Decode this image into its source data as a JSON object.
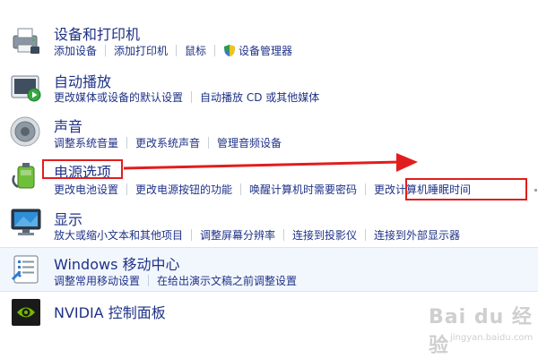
{
  "categories": [
    {
      "title": "设备和打印机",
      "icon": "printer-icon",
      "links": [
        "添加设备",
        "添加打印机",
        "鼠标",
        "设备管理器"
      ]
    },
    {
      "title": "自动播放",
      "icon": "autoplay-icon",
      "links": [
        "更改媒体或设备的默认设置",
        "自动播放 CD 或其他媒体"
      ]
    },
    {
      "title": "声音",
      "icon": "speaker-icon",
      "links": [
        "调整系统音量",
        "更改系统声音",
        "管理音频设备"
      ]
    },
    {
      "title": "电源选项",
      "icon": "power-options-icon",
      "links": [
        "更改电池设置",
        "更改电源按钮的功能",
        "唤醒计算机时需要密码",
        "更改计算机睡眠时间"
      ]
    },
    {
      "title": "显示",
      "icon": "display-icon",
      "links": [
        "放大或缩小文本和其他项目",
        "调整屏幕分辨率",
        "连接到投影仪",
        "连接到外部显示器"
      ]
    },
    {
      "title": "Windows 移动中心",
      "icon": "mobility-center-icon",
      "links": [
        "调整常用移动设置",
        "在给出演示文稿之前调整设置"
      ]
    },
    {
      "title": "NVIDIA 控制面板",
      "icon": "nvidia-icon",
      "links": []
    }
  ],
  "watermark": {
    "logo": "Bai du 经验",
    "url": "jingyan.baidu.com"
  },
  "colors": {
    "link": "#1e3287",
    "annotation": "#e21d1d",
    "highlight": "#f2f7fd"
  }
}
